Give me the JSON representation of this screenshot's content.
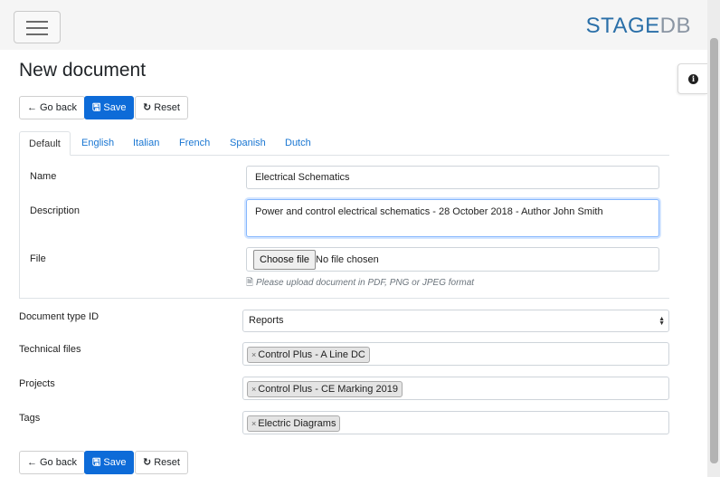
{
  "brand": {
    "logo_part1": "STAGE",
    "logo_part2": "DB"
  },
  "page": {
    "title": "New document"
  },
  "toolbar": {
    "back_label": "Go back",
    "save_label": "Save",
    "reset_label": "Reset"
  },
  "tabs": [
    "Default",
    "English",
    "Italian",
    "French",
    "Spanish",
    "Dutch"
  ],
  "form": {
    "name_label": "Name",
    "name_value": "Electrical Schematics",
    "description_label": "Description",
    "description_value": "Power and control electrical schematics - 28 October 2018 - Author John Smith",
    "file_label": "File",
    "file_button": "Choose file",
    "file_status": "No file chosen",
    "file_help": "Please upload document in PDF, PNG or JPEG format",
    "doctype_label": "Document type ID",
    "doctype_value": "Reports",
    "technical_files_label": "Technical files",
    "technical_files_tag": "Control Plus - A Line DC",
    "projects_label": "Projects",
    "projects_tag": "Control Plus - CE Marking 2019",
    "tags_label": "Tags",
    "tags_tag": "Electric Diagrams"
  },
  "colors": {
    "primary": "#0d6bd8",
    "link": "#1976d2",
    "logo_blue": "#2a6fa8",
    "logo_gray": "#8a95a3"
  }
}
